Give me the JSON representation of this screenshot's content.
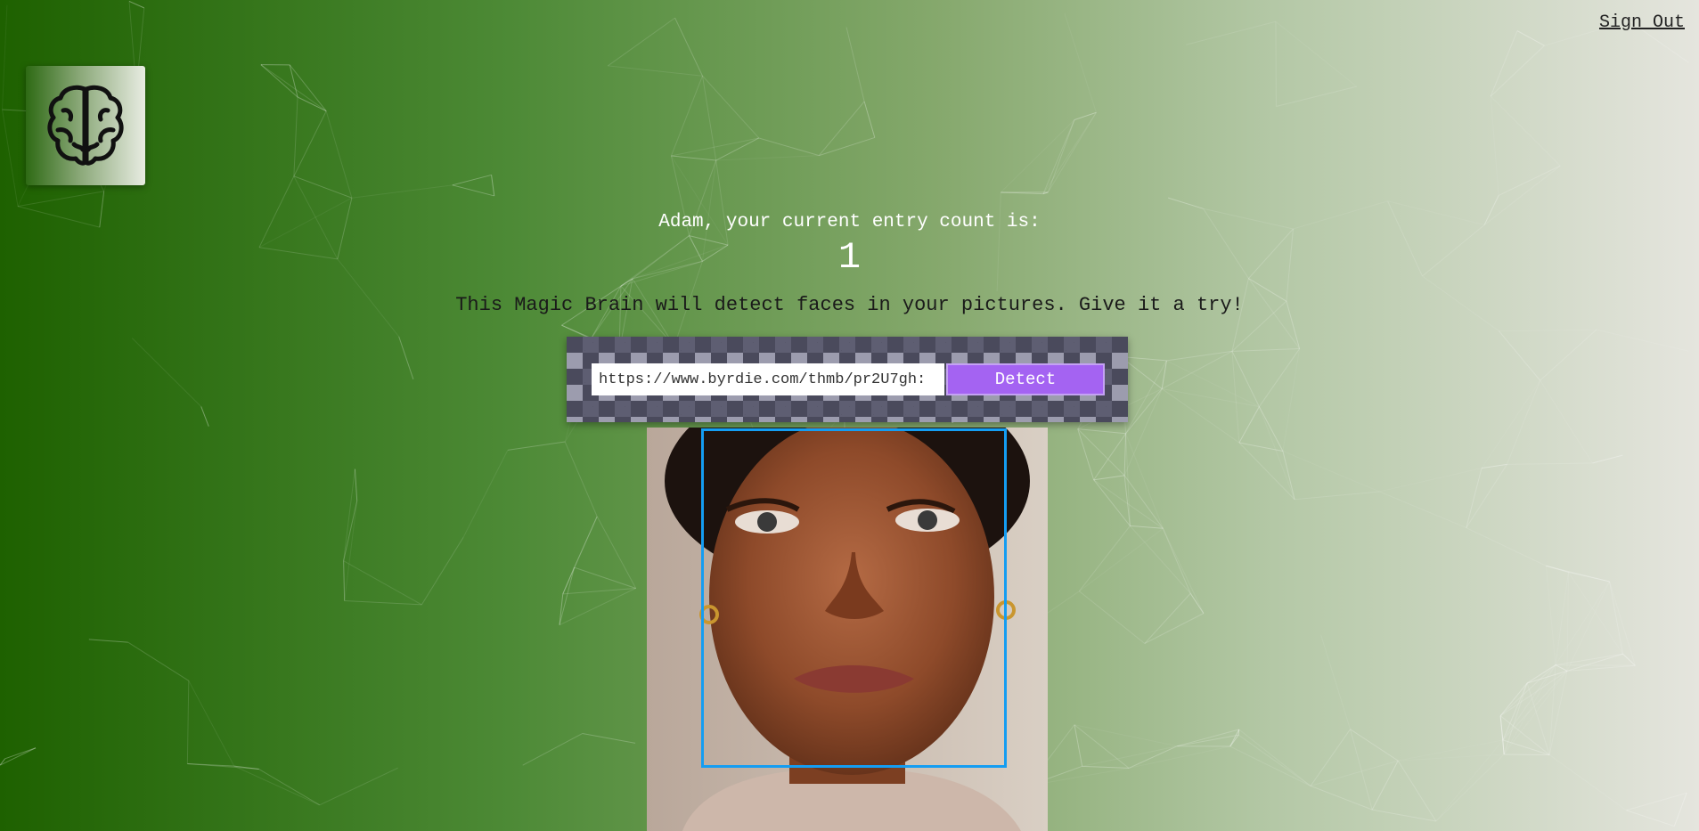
{
  "header": {
    "sign_out_label": "Sign Out"
  },
  "logo": {
    "icon": "brain-icon"
  },
  "entry": {
    "message": "Adam, your current entry count is:",
    "count": "1"
  },
  "tagline": "This Magic Brain will detect faces in your pictures. Give it a try!",
  "form": {
    "url_value": "https://www.byrdie.com/thmb/pr2U7gh:",
    "detect_label": "Detect"
  },
  "image": {
    "subject": "face-photo",
    "box_color": "#149df2"
  },
  "colors": {
    "background_start": "#1e6100",
    "background_end": "#e5e5de",
    "button": "#a463f2"
  }
}
